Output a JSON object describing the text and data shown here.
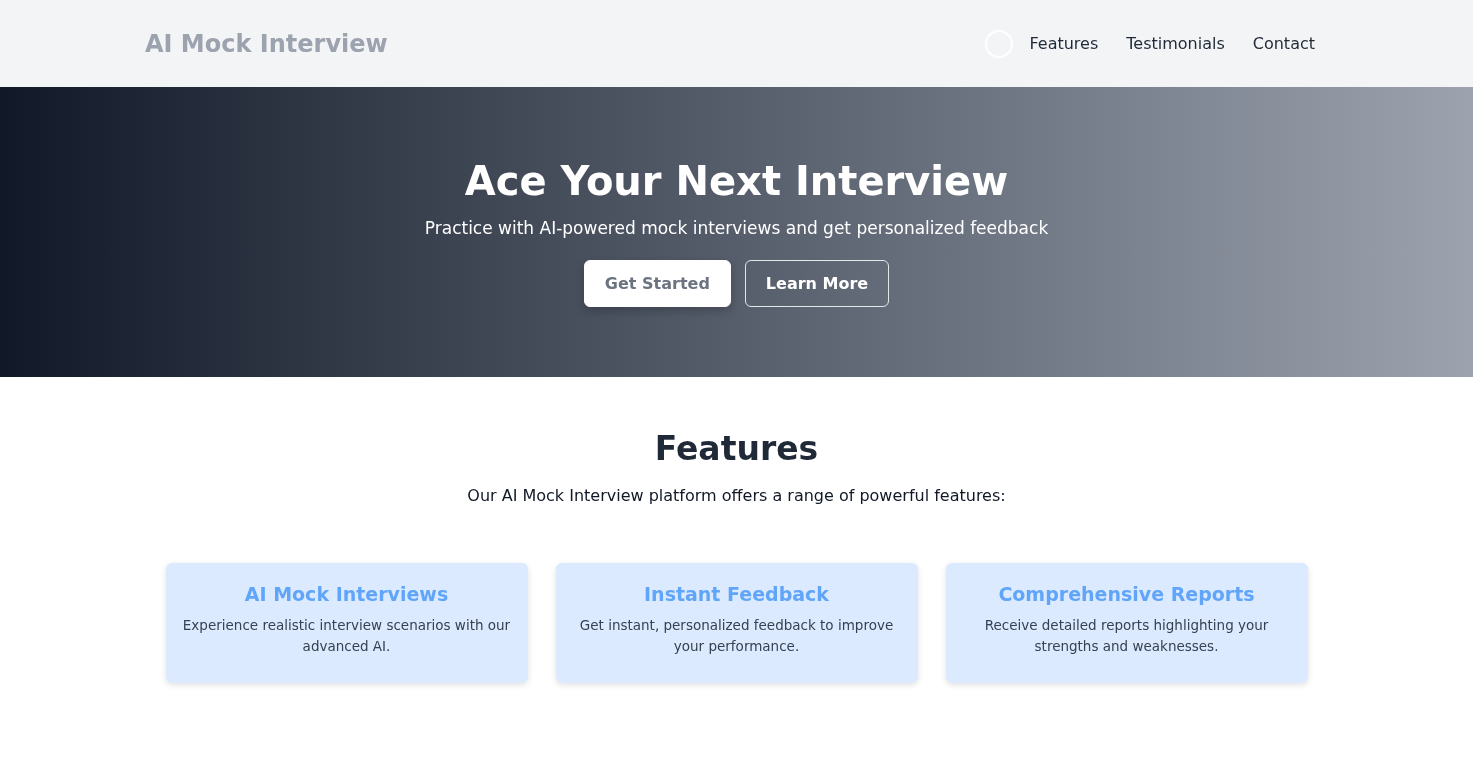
{
  "header": {
    "logo": "AI Mock Interview",
    "nav": [
      {
        "label": "Features"
      },
      {
        "label": "Testimonials"
      },
      {
        "label": "Contact"
      }
    ]
  },
  "hero": {
    "title": "Ace Your Next Interview",
    "subtitle": "Practice with AI-powered mock interviews and get personalized feedback",
    "buttons": [
      {
        "label": "Get Started",
        "kind": "primary"
      },
      {
        "label": "Learn More",
        "kind": "outline"
      }
    ]
  },
  "features": {
    "title": "Features",
    "intro": "Our AI Mock Interview platform offers a range of powerful features:",
    "cards": [
      {
        "title": "AI Mock Interviews",
        "text": "Experience realistic interview scenarios with our advanced AI."
      },
      {
        "title": "Instant Feedback",
        "text": "Get instant, personalized feedback to improve your performance."
      },
      {
        "title": "Comprehensive Reports",
        "text": "Receive detailed reports highlighting your strengths and weaknesses."
      }
    ]
  }
}
